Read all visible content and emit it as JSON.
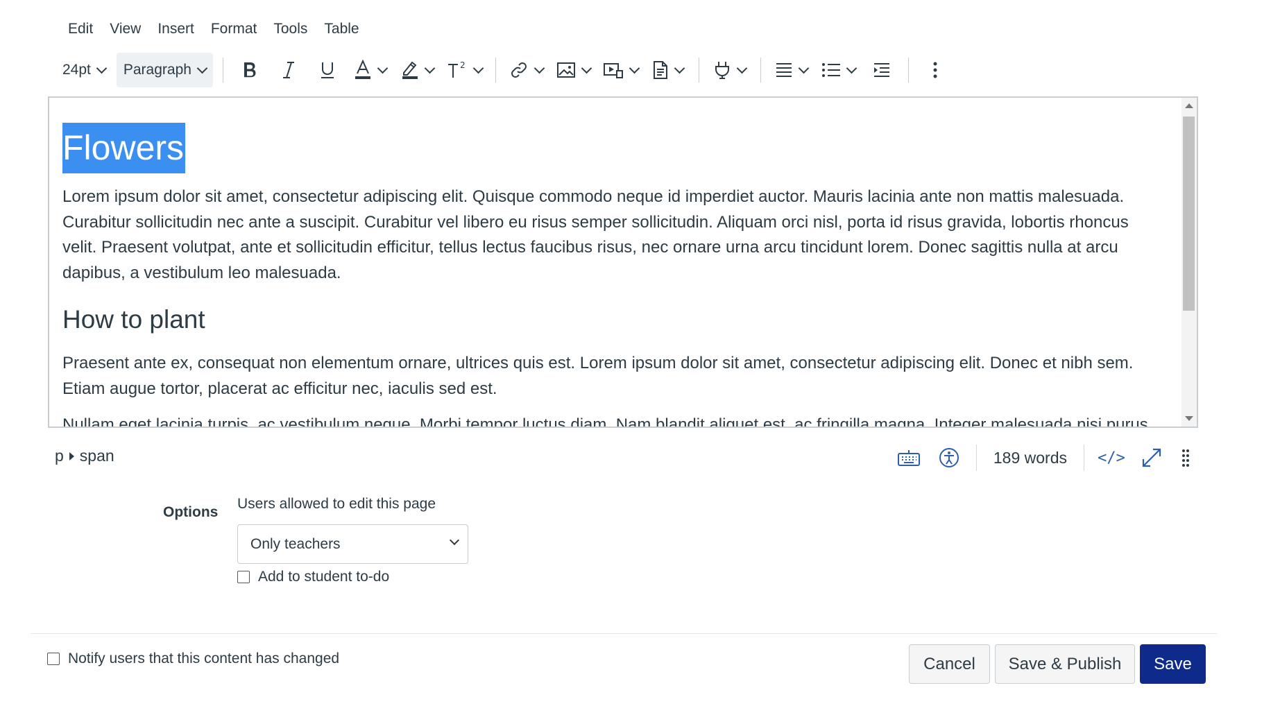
{
  "menubar": {
    "items": [
      "Edit",
      "View",
      "Insert",
      "Format",
      "Tools",
      "Table"
    ]
  },
  "toolbar": {
    "font_size": "24pt",
    "block_format": "Paragraph"
  },
  "editor": {
    "heading1": "Flowers",
    "paragraph1": "Lorem ipsum dolor sit amet, consectetur adipiscing elit. Quisque commodo neque id imperdiet auctor. Mauris lacinia ante non mattis malesuada. Curabitur sollicitudin nec ante a suscipit. Curabitur vel libero eu risus semper sollicitudin. Aliquam orci nisl, porta id risus gravida, lobortis rhoncus velit. Praesent volutpat, ante et sollicitudin efficitur, tellus lectus faucibus risus, nec ornare urna arcu tincidunt lorem. Donec sagittis nulla at arcu dapibus, a vestibulum leo malesuada.",
    "heading2": "How to plant",
    "paragraph2": "Praesent ante ex, consequat non elementum ornare, ultrices quis est. Lorem ipsum dolor sit amet, consectetur adipiscing elit. Donec et nibh sem. Etiam augue tortor, placerat ac efficitur nec, iaculis sed est.",
    "paragraph3": "Nullam eget lacinia turpis, ac vestibulum neque. Morbi tempor luctus diam. Nam blandit aliquet est, ac fringilla magna. Integer malesuada nisi purus"
  },
  "statusbar": {
    "path_p": "p",
    "path_span": "span",
    "word_count": "189 words",
    "html_toggle": "</>"
  },
  "options": {
    "label": "Options",
    "edit_permission_label": "Users allowed to edit this page",
    "edit_permission_value": "Only teachers",
    "todo_label": "Add to student to-do"
  },
  "footer": {
    "notify_label": "Notify users that this content has changed",
    "cancel": "Cancel",
    "save_publish": "Save & Publish",
    "save": "Save"
  },
  "colors": {
    "selection": "#3a8ff0",
    "primary_button": "#0e2a8a",
    "text": "#2d3b45",
    "status_icons": "#2d5fa8"
  }
}
